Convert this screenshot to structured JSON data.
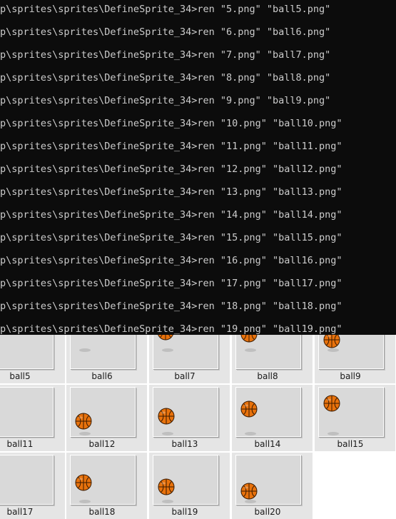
{
  "console": {
    "lines": [
      "p\\sprites\\sprites\\DefineSprite_34>ren \"5.png\" \"ball5.png\"",
      "p\\sprites\\sprites\\DefineSprite_34>ren \"6.png\" \"ball6.png\"",
      "p\\sprites\\sprites\\DefineSprite_34>ren \"7.png\" \"ball7.png\"",
      "p\\sprites\\sprites\\DefineSprite_34>ren \"8.png\" \"ball8.png\"",
      "p\\sprites\\sprites\\DefineSprite_34>ren \"9.png\" \"ball9.png\"",
      "p\\sprites\\sprites\\DefineSprite_34>ren \"10.png\" \"ball10.png\"",
      "p\\sprites\\sprites\\DefineSprite_34>ren \"11.png\" \"ball11.png\"",
      "p\\sprites\\sprites\\DefineSprite_34>ren \"12.png\" \"ball12.png\"",
      "p\\sprites\\sprites\\DefineSprite_34>ren \"13.png\" \"ball13.png\"",
      "p\\sprites\\sprites\\DefineSprite_34>ren \"14.png\" \"ball14.png\"",
      "p\\sprites\\sprites\\DefineSprite_34>ren \"15.png\" \"ball15.png\"",
      "p\\sprites\\sprites\\DefineSprite_34>ren \"16.png\" \"ball16.png\"",
      "p\\sprites\\sprites\\DefineSprite_34>ren \"17.png\" \"ball17.png\"",
      "p\\sprites\\sprites\\DefineSprite_34>ren \"18.png\" \"ball18.png\"",
      "p\\sprites\\sprites\\DefineSprite_34>ren \"19.png\" \"ball19.png\""
    ]
  },
  "explorer": {
    "files": [
      {
        "name": "ball5",
        "icon": "basketball-thumbnail"
      },
      {
        "name": "ball6",
        "icon": "basketball-thumbnail"
      },
      {
        "name": "ball7",
        "icon": "basketball-thumbnail"
      },
      {
        "name": "ball8",
        "icon": "basketball-thumbnail"
      },
      {
        "name": "ball9",
        "icon": "basketball-thumbnail"
      },
      {
        "name": "ball11",
        "icon": "basketball-thumbnail"
      },
      {
        "name": "ball12",
        "icon": "basketball-thumbnail"
      },
      {
        "name": "ball13",
        "icon": "basketball-thumbnail"
      },
      {
        "name": "ball14",
        "icon": "basketball-thumbnail"
      },
      {
        "name": "ball15",
        "icon": "basketball-thumbnail"
      },
      {
        "name": "ball17",
        "icon": "basketball-thumbnail"
      },
      {
        "name": "ball18",
        "icon": "basketball-thumbnail"
      },
      {
        "name": "ball19",
        "icon": "basketball-thumbnail"
      },
      {
        "name": "ball20",
        "icon": "basketball-thumbnail"
      }
    ]
  },
  "colors": {
    "console_bg": "#0c0c0c",
    "console_text": "#cccccc",
    "ball_orange": "#e8720c",
    "ball_seams": "#3a1a00"
  }
}
